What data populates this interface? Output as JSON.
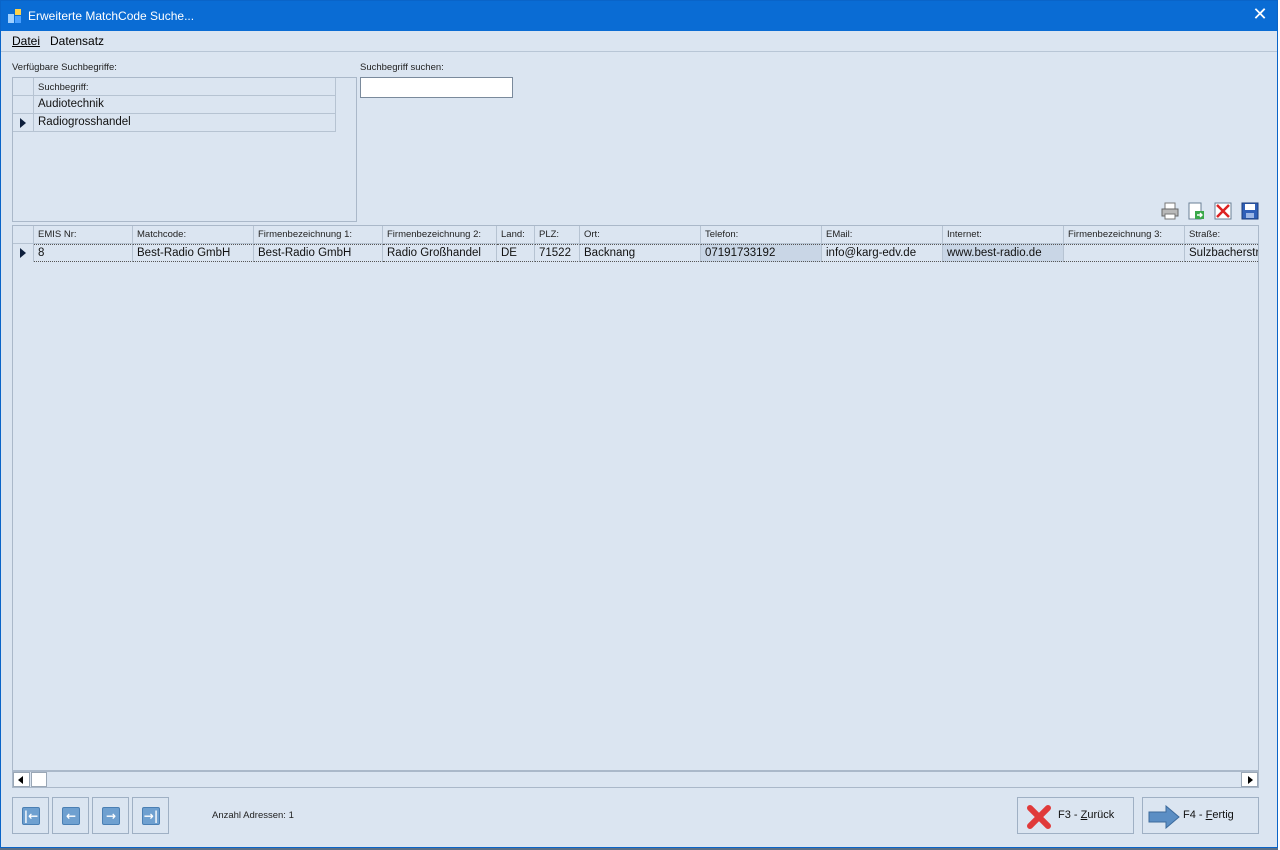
{
  "window": {
    "title": "Erweiterte MatchCode Suche..."
  },
  "menu": {
    "items": [
      "Datei",
      "Datensatz"
    ]
  },
  "terms": {
    "label": "Verfügbare Suchbegriffe:",
    "header": "Suchbegriff:",
    "rows": [
      "Audiotechnik",
      "Radiogrosshandel"
    ],
    "selected_index": 1
  },
  "search": {
    "label": "Suchbegriff suchen:",
    "value": ""
  },
  "toolbar": {
    "icons": [
      "printer-icon",
      "export-icon",
      "delete-icon",
      "save-icon"
    ]
  },
  "grid": {
    "columns": [
      "EMIS Nr:",
      "Matchcode:",
      "Firmenbezeichnung 1:",
      "Firmenbezeichnung 2:",
      "Land:",
      "PLZ:",
      "Ort:",
      "Telefon:",
      "EMail:",
      "Internet:",
      "Firmenbezeichnung 3:",
      "Straße:"
    ],
    "rows": [
      [
        "8",
        "Best-Radio GmbH",
        "Best-Radio GmbH",
        "Radio Großhandel",
        "DE",
        "71522",
        "Backnang",
        "07191733192",
        "info@karg-edv.de",
        "www.best-radio.de",
        "",
        "Sulzbacherstr"
      ]
    ]
  },
  "footer": {
    "count_label": "Anzahl Adressen: 1",
    "nav_icons": [
      "first-record-icon",
      "previous-record-icon",
      "next-record-icon",
      "last-record-icon"
    ],
    "back": {
      "prefix": "F3 - ",
      "underlined": "Z",
      "rest": "urück"
    },
    "done": {
      "prefix": "F4 - ",
      "underlined": "F",
      "rest": "ertig"
    }
  },
  "colors": {
    "titlebar": "#0a6cd4",
    "background": "#dbe5f1",
    "accent": "#0a6cd4"
  }
}
